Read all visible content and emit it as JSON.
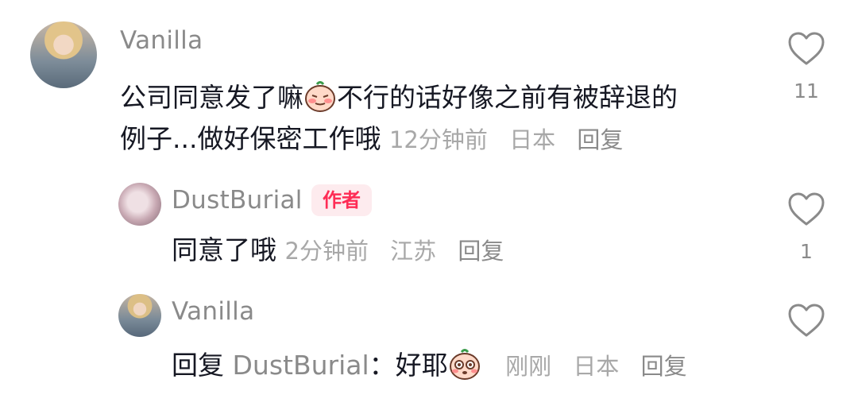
{
  "comments": [
    {
      "username": "Vanilla",
      "text_part1": "公司同意发了嘛",
      "text_part2": "不行的话好像之前有被辞退的",
      "text_line2": "例子...做好保密工作哦",
      "time": "12分钟前",
      "location": "日本",
      "reply_label": "回复",
      "like_count": "11"
    },
    {
      "username": "DustBurial",
      "badge": "作者",
      "text": "同意了哦",
      "time": "2分钟前",
      "location": "江苏",
      "reply_label": "回复",
      "like_count": "1"
    },
    {
      "username": "Vanilla",
      "reply_prefix": "回复",
      "reply_target": "DustBurial",
      "colon": "：",
      "text": "好耶",
      "time": "刚刚",
      "location": "日本",
      "reply_label": "回复",
      "like_count": ""
    }
  ],
  "icons": {
    "like": "heart-outline-icon",
    "emoji_1": "blush-face-emoji",
    "emoji_2": "teary-face-emoji"
  },
  "colors": {
    "badge_text": "#fe2c55",
    "badge_bg": "#fdebee",
    "username": "#8a8a8a",
    "text": "#161823",
    "meta": "#a8a8a8"
  }
}
